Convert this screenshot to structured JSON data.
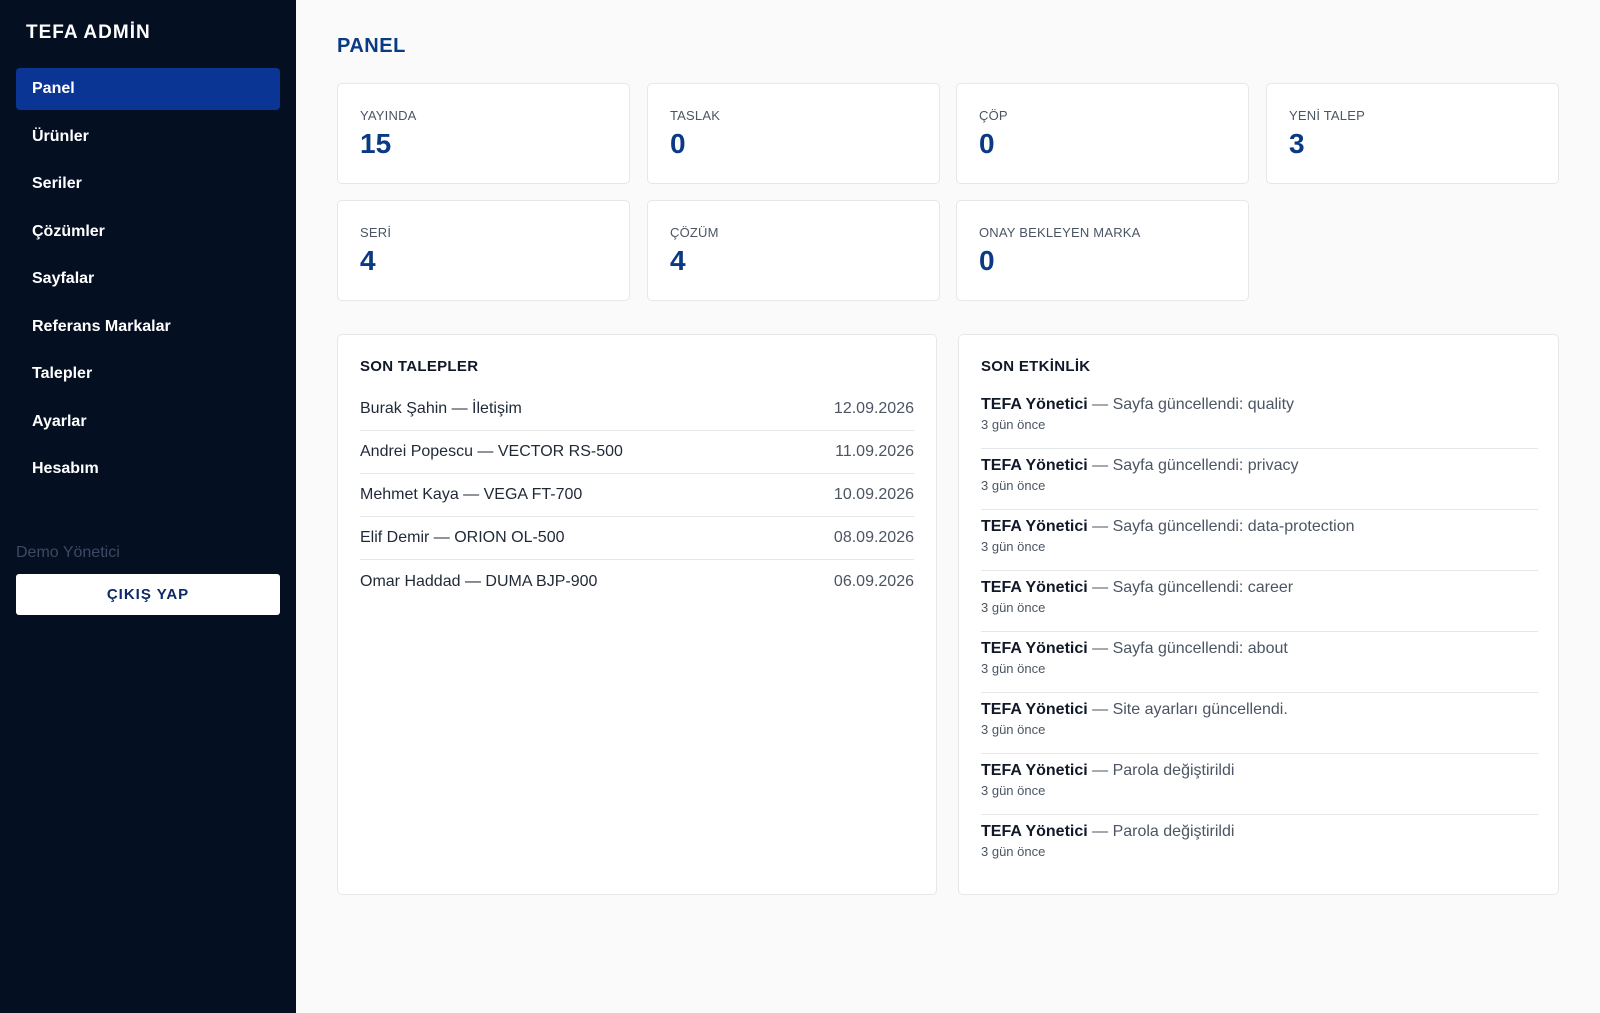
{
  "sidebar": {
    "brand": "TEFA ADMİN",
    "items": [
      {
        "label": "Panel"
      },
      {
        "label": "Ürünler"
      },
      {
        "label": "Seriler"
      },
      {
        "label": "Çözümler"
      },
      {
        "label": "Sayfalar"
      },
      {
        "label": "Referans Markalar"
      },
      {
        "label": "Talepler"
      },
      {
        "label": "Ayarlar"
      },
      {
        "label": "Hesabım"
      }
    ],
    "active_item": "Panel",
    "user_name": "Demo Yönetici",
    "logout_label": "ÇIKIŞ YAP"
  },
  "main": {
    "title": "PANEL",
    "stats": [
      {
        "label": "YAYINDA",
        "value": "15"
      },
      {
        "label": "TASLAK",
        "value": "0"
      },
      {
        "label": "ÇÖP",
        "value": "0"
      },
      {
        "label": "YENİ TALEP",
        "value": "3"
      },
      {
        "label": "SERİ",
        "value": "4"
      },
      {
        "label": "ÇÖZÜM",
        "value": "4"
      },
      {
        "label": "ONAY BEKLEYEN MARKA",
        "value": "0"
      }
    ],
    "requests": {
      "title": "SON TALEPLER",
      "rows": [
        {
          "text": "Burak Şahin — İletişim",
          "date": "12.09.2026"
        },
        {
          "text": "Andrei Popescu — VECTOR RS-500",
          "date": "11.09.2026"
        },
        {
          "text": "Mehmet Kaya — VEGA FT-700",
          "date": "10.09.2026"
        },
        {
          "text": "Elif Demir — ORION OL-500",
          "date": "08.09.2026"
        },
        {
          "text": "Omar Haddad — DUMA BJP-900",
          "date": "06.09.2026"
        }
      ]
    },
    "activity": {
      "title": "SON ETKİNLİK",
      "rows": [
        {
          "user": "TEFA Yönetici",
          "action": " — Sayfa güncellendi: quality",
          "time": "3 gün önce"
        },
        {
          "user": "TEFA Yönetici",
          "action": " — Sayfa güncellendi: privacy",
          "time": "3 gün önce"
        },
        {
          "user": "TEFA Yönetici",
          "action": " — Sayfa güncellendi: data-protection",
          "time": "3 gün önce"
        },
        {
          "user": "TEFA Yönetici",
          "action": " — Sayfa güncellendi: career",
          "time": "3 gün önce"
        },
        {
          "user": "TEFA Yönetici",
          "action": " — Sayfa güncellendi: about",
          "time": "3 gün önce"
        },
        {
          "user": "TEFA Yönetici",
          "action": " — Site ayarları güncellendi.",
          "time": "3 gün önce"
        },
        {
          "user": "TEFA Yönetici",
          "action": " — Parola değiştirildi",
          "time": "3 gün önce"
        },
        {
          "user": "TEFA Yönetici",
          "action": " — Parola değiştirildi",
          "time": "3 gün önce"
        }
      ]
    }
  },
  "colors": {
    "sidebar_bg": "#050f22",
    "active_nav": "#0b3595",
    "accent_text": "#0b3a84",
    "main_bg": "#fafafa"
  }
}
